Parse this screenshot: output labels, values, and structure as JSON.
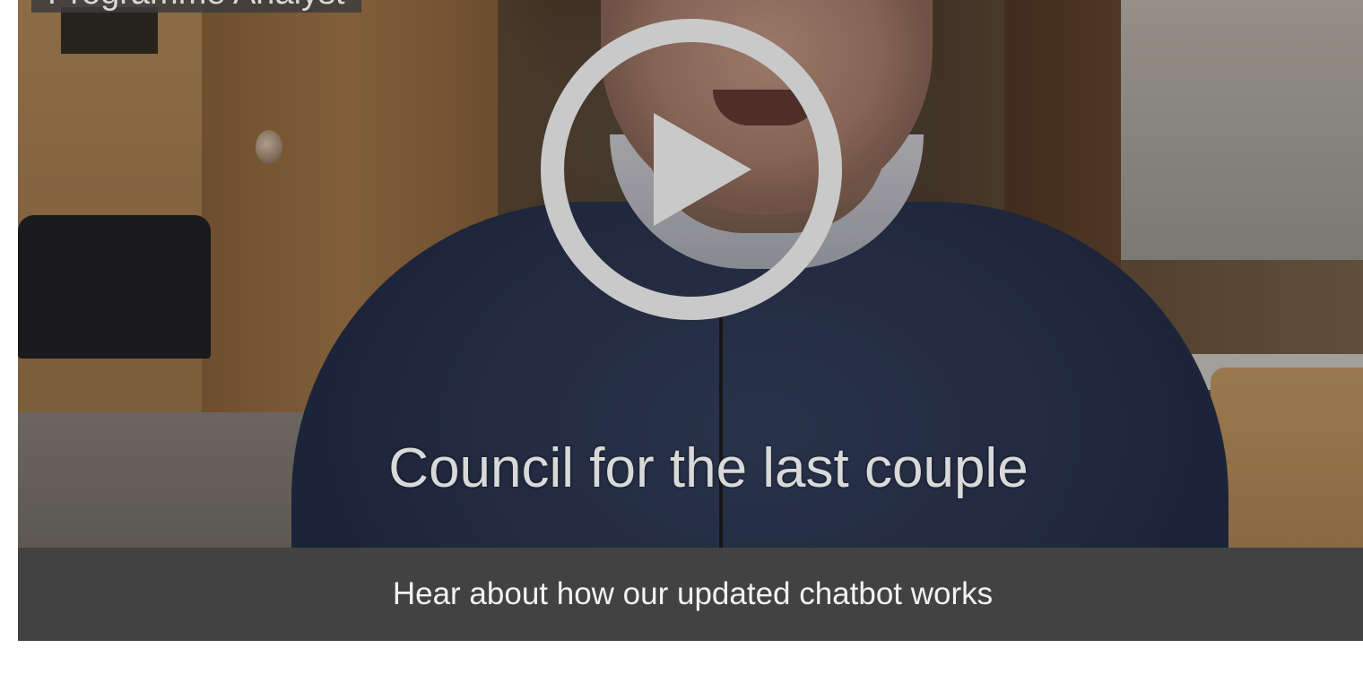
{
  "video": {
    "title_overlay": "Programme Analyst",
    "subtitle": "Council for the last couple",
    "play_label": "Play video"
  },
  "caption_bar": {
    "text": "Hear about how our updated chatbot works"
  },
  "colors": {
    "caption_bar_bg": "#424242",
    "caption_text": "#f2f2f2",
    "play_icon": "#c9c9c9"
  },
  "icons": {
    "play": "play-circle-icon"
  }
}
